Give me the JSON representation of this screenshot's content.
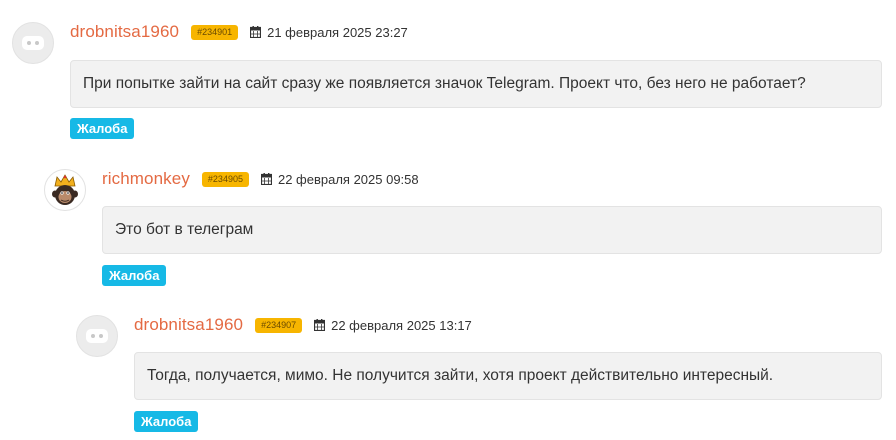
{
  "comments": [
    {
      "username": "drobnitsa1960",
      "id_badge": "#234901",
      "date": "21 февраля 2025 23:27",
      "text": "При попытке зайти на сайт сразу же появляется значок Telegram. Проект что, без него не работает?",
      "complaint_label": "Жалоба",
      "avatar": "bot-avatar-icon"
    },
    {
      "username": "richmonkey",
      "id_badge": "#234905",
      "date": "22 февраля 2025 09:58",
      "text": "Это бот в телеграм",
      "complaint_label": "Жалоба",
      "avatar": "monkey-king-avatar-icon"
    },
    {
      "username": "drobnitsa1960",
      "id_badge": "#234907",
      "date": "22 февраля 2025 13:17",
      "text": "Тогда, получается, мимо. Не получится зайти, хотя проект действительно интересный.",
      "complaint_label": "Жалоба",
      "avatar": "bot-avatar-icon"
    }
  ],
  "colors": {
    "username": "#e46a43",
    "badge": "#f7b500",
    "complaint_button": "#16b9e6",
    "bubble_bg": "#f2f2f2"
  }
}
